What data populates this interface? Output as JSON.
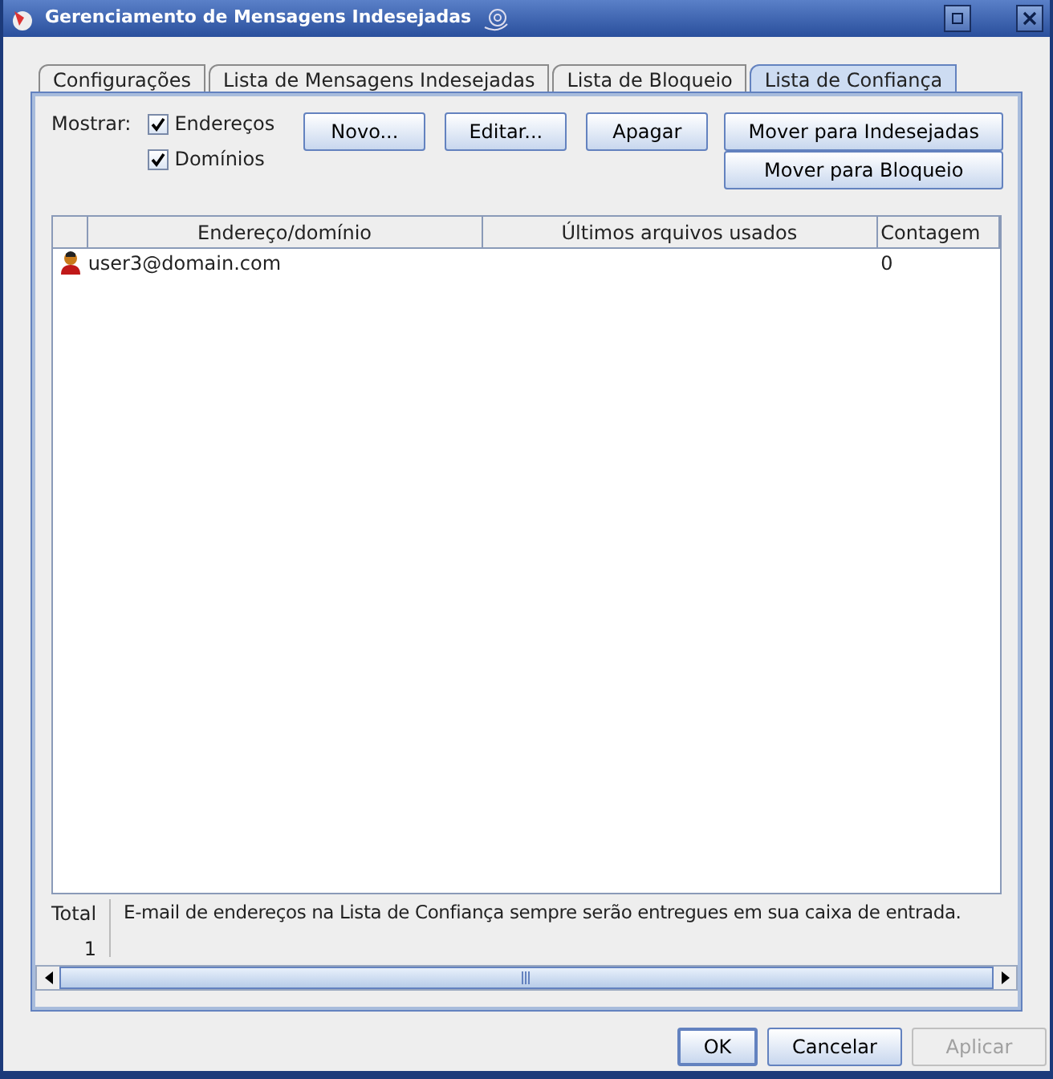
{
  "window": {
    "title": "Gerenciamento de Mensagens Indesejadas"
  },
  "tabs": [
    {
      "label": "Configurações",
      "selected": false
    },
    {
      "label": "Lista de Mensagens Indesejadas",
      "selected": false
    },
    {
      "label": "Lista de Bloqueio",
      "selected": false
    },
    {
      "label": "Lista de Confiança",
      "selected": true
    }
  ],
  "show": {
    "label": "Mostrar:",
    "options": [
      {
        "label": "Endereços",
        "checked": true
      },
      {
        "label": "Domínios",
        "checked": true
      }
    ]
  },
  "actions": [
    "Novo...",
    "Editar...",
    "Apagar"
  ],
  "move_buttons": [
    "Mover para Indesejadas",
    "Mover para Bloqueio"
  ],
  "table": {
    "columns": [
      "Endereço/domínio",
      "Últimos arquivos usados",
      "Contagem"
    ],
    "rows": [
      {
        "address": "user3@domain.com",
        "last_files": "",
        "count": "0"
      }
    ]
  },
  "total": {
    "label": "Total",
    "value": "1"
  },
  "note": "E-mail de endereços na Lista de Confiança sempre serão entregues em sua caixa de entrada.",
  "buttons": [
    {
      "label": "OK",
      "disabled": false
    },
    {
      "label": "Cancelar",
      "disabled": false
    },
    {
      "label": "Aplicar",
      "disabled": true
    }
  ]
}
